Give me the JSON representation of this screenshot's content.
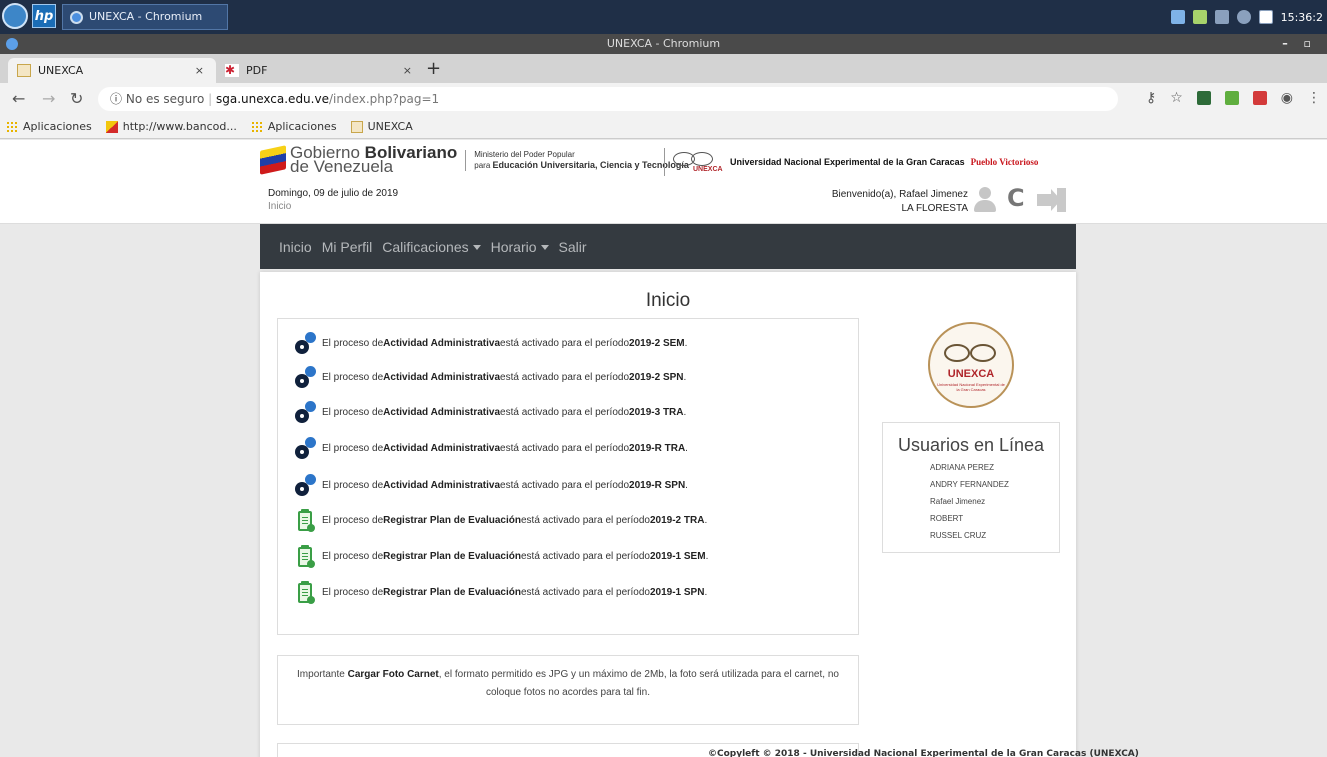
{
  "taskbar": {
    "task_label": "UNEXCA - Chromium",
    "clock": "15:36:2"
  },
  "window": {
    "title": "UNEXCA - Chromium"
  },
  "tabs": [
    {
      "label": "UNEXCA"
    },
    {
      "label": "PDF"
    }
  ],
  "toolbar": {
    "security": "No es seguro",
    "host": "sga.unexca.edu.ve",
    "path": "/index.php?pag=1"
  },
  "bookmarks": [
    {
      "label": "Aplicaciones"
    },
    {
      "label": "http://www.bancod..."
    },
    {
      "label": "Aplicaciones"
    },
    {
      "label": "UNEXCA"
    }
  ],
  "header": {
    "gob_line1_pre": "Gobierno ",
    "gob_line1_bold": "Bolivariano",
    "gob_line2": "de Venezuela",
    "ministerio_line1": "Ministerio del Poder Popular",
    "ministerio_pre": "para ",
    "ministerio_bold": "Educación Universitaria, Ciencia y Tecnología",
    "unexca_logo_text": "UNEXCA",
    "university_name": "Universidad Nacional Experimental de la Gran Caracas",
    "pueblo_text": "Pueblo Victorioso",
    "date": "Domingo, 09 de julio de 2019",
    "breadcrumb": "Inicio",
    "welcome": "Bienvenido(a), Rafael Jimenez",
    "location": "LA FLORESTA"
  },
  "navbar": {
    "items": [
      "Inicio",
      "Mi Perfil",
      "Calificaciones",
      "Horario",
      "Salir"
    ]
  },
  "main": {
    "title": "Inicio",
    "processes": [
      {
        "pre": "El proceso de ",
        "name": "Actividad Administrativa",
        "mid": " está activado para el período ",
        "period": "2019-2 SEM",
        "post": ".",
        "icon": "gears-icon"
      },
      {
        "pre": "El proceso de ",
        "name": "Actividad Administrativa",
        "mid": " está activado para el período ",
        "period": "2019-2 SPN",
        "post": ".",
        "icon": "gears-icon"
      },
      {
        "pre": "El proceso de ",
        "name": "Actividad Administrativa",
        "mid": " está activado para el período ",
        "period": "2019-3 TRA",
        "post": ".",
        "icon": "gears-icon"
      },
      {
        "pre": "El proceso de ",
        "name": "Actividad Administrativa",
        "mid": " está activado para el período ",
        "period": "2019-R TRA",
        "post": ".",
        "icon": "gears-icon"
      },
      {
        "pre": "El proceso de ",
        "name": "Actividad Administrativa",
        "mid": " está activado para el período ",
        "period": "2019-R SPN",
        "post": ".",
        "icon": "gears-icon"
      },
      {
        "pre": "El proceso de ",
        "name": "Registrar Plan de Evaluación",
        "mid": " está activado para el período ",
        "period": "2019-2 TRA",
        "post": ".",
        "icon": "clipboard-icon"
      },
      {
        "pre": "El proceso de ",
        "name": "Registrar Plan de Evaluación",
        "mid": " está activado para el período ",
        "period": "2019-1 SEM",
        "post": ".",
        "icon": "clipboard-icon"
      },
      {
        "pre": "El proceso de ",
        "name": "Registrar Plan de Evaluación",
        "mid": " está activado para el período ",
        "period": "2019-1 SPN",
        "post": ".",
        "icon": "clipboard-icon"
      }
    ],
    "logo": {
      "text": "UNEXCA",
      "subtext": "Universidad Nacional Experimental de la Gran Caracas"
    },
    "online": {
      "title": "Usuarios en Línea",
      "users": [
        "ADRIANA PEREZ",
        "ANDRY FERNANDEZ",
        "Rafael Jimenez",
        "ROBERT",
        "RUSSEL CRUZ"
      ]
    },
    "notice": {
      "pre": "Importante ",
      "bold": "Cargar Foto Carnet",
      "post": ", el formato permitido es JPG y un máximo de 2Mb, la foto será utilizada para el carnet, no coloque fotos no acordes para tal fin."
    },
    "copyleft": "©Copyleft © 2018 - Universidad Nacional Experimental de la Gran Caracas (UNEXCA)"
  },
  "colors": {
    "navbar_bg": "#343a40",
    "accent_red": "#b0262b",
    "gear_blue": "#2c75c9",
    "clip_green": "#3a9e46"
  }
}
